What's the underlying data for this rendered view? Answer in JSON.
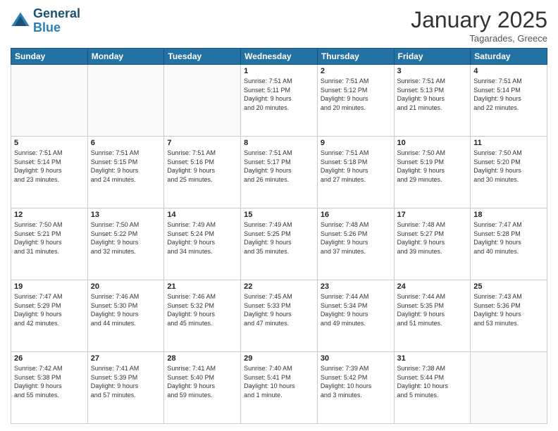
{
  "header": {
    "logo_line1": "General",
    "logo_line2": "Blue",
    "month": "January 2025",
    "location": "Tagarades, Greece"
  },
  "weekdays": [
    "Sunday",
    "Monday",
    "Tuesday",
    "Wednesday",
    "Thursday",
    "Friday",
    "Saturday"
  ],
  "weeks": [
    [
      {
        "day": "",
        "info": ""
      },
      {
        "day": "",
        "info": ""
      },
      {
        "day": "",
        "info": ""
      },
      {
        "day": "1",
        "info": "Sunrise: 7:51 AM\nSunset: 5:11 PM\nDaylight: 9 hours\nand 20 minutes."
      },
      {
        "day": "2",
        "info": "Sunrise: 7:51 AM\nSunset: 5:12 PM\nDaylight: 9 hours\nand 20 minutes."
      },
      {
        "day": "3",
        "info": "Sunrise: 7:51 AM\nSunset: 5:13 PM\nDaylight: 9 hours\nand 21 minutes."
      },
      {
        "day": "4",
        "info": "Sunrise: 7:51 AM\nSunset: 5:14 PM\nDaylight: 9 hours\nand 22 minutes."
      }
    ],
    [
      {
        "day": "5",
        "info": "Sunrise: 7:51 AM\nSunset: 5:14 PM\nDaylight: 9 hours\nand 23 minutes."
      },
      {
        "day": "6",
        "info": "Sunrise: 7:51 AM\nSunset: 5:15 PM\nDaylight: 9 hours\nand 24 minutes."
      },
      {
        "day": "7",
        "info": "Sunrise: 7:51 AM\nSunset: 5:16 PM\nDaylight: 9 hours\nand 25 minutes."
      },
      {
        "day": "8",
        "info": "Sunrise: 7:51 AM\nSunset: 5:17 PM\nDaylight: 9 hours\nand 26 minutes."
      },
      {
        "day": "9",
        "info": "Sunrise: 7:51 AM\nSunset: 5:18 PM\nDaylight: 9 hours\nand 27 minutes."
      },
      {
        "day": "10",
        "info": "Sunrise: 7:50 AM\nSunset: 5:19 PM\nDaylight: 9 hours\nand 29 minutes."
      },
      {
        "day": "11",
        "info": "Sunrise: 7:50 AM\nSunset: 5:20 PM\nDaylight: 9 hours\nand 30 minutes."
      }
    ],
    [
      {
        "day": "12",
        "info": "Sunrise: 7:50 AM\nSunset: 5:21 PM\nDaylight: 9 hours\nand 31 minutes."
      },
      {
        "day": "13",
        "info": "Sunrise: 7:50 AM\nSunset: 5:22 PM\nDaylight: 9 hours\nand 32 minutes."
      },
      {
        "day": "14",
        "info": "Sunrise: 7:49 AM\nSunset: 5:24 PM\nDaylight: 9 hours\nand 34 minutes."
      },
      {
        "day": "15",
        "info": "Sunrise: 7:49 AM\nSunset: 5:25 PM\nDaylight: 9 hours\nand 35 minutes."
      },
      {
        "day": "16",
        "info": "Sunrise: 7:48 AM\nSunset: 5:26 PM\nDaylight: 9 hours\nand 37 minutes."
      },
      {
        "day": "17",
        "info": "Sunrise: 7:48 AM\nSunset: 5:27 PM\nDaylight: 9 hours\nand 39 minutes."
      },
      {
        "day": "18",
        "info": "Sunrise: 7:47 AM\nSunset: 5:28 PM\nDaylight: 9 hours\nand 40 minutes."
      }
    ],
    [
      {
        "day": "19",
        "info": "Sunrise: 7:47 AM\nSunset: 5:29 PM\nDaylight: 9 hours\nand 42 minutes."
      },
      {
        "day": "20",
        "info": "Sunrise: 7:46 AM\nSunset: 5:30 PM\nDaylight: 9 hours\nand 44 minutes."
      },
      {
        "day": "21",
        "info": "Sunrise: 7:46 AM\nSunset: 5:32 PM\nDaylight: 9 hours\nand 45 minutes."
      },
      {
        "day": "22",
        "info": "Sunrise: 7:45 AM\nSunset: 5:33 PM\nDaylight: 9 hours\nand 47 minutes."
      },
      {
        "day": "23",
        "info": "Sunrise: 7:44 AM\nSunset: 5:34 PM\nDaylight: 9 hours\nand 49 minutes."
      },
      {
        "day": "24",
        "info": "Sunrise: 7:44 AM\nSunset: 5:35 PM\nDaylight: 9 hours\nand 51 minutes."
      },
      {
        "day": "25",
        "info": "Sunrise: 7:43 AM\nSunset: 5:36 PM\nDaylight: 9 hours\nand 53 minutes."
      }
    ],
    [
      {
        "day": "26",
        "info": "Sunrise: 7:42 AM\nSunset: 5:38 PM\nDaylight: 9 hours\nand 55 minutes."
      },
      {
        "day": "27",
        "info": "Sunrise: 7:41 AM\nSunset: 5:39 PM\nDaylight: 9 hours\nand 57 minutes."
      },
      {
        "day": "28",
        "info": "Sunrise: 7:41 AM\nSunset: 5:40 PM\nDaylight: 9 hours\nand 59 minutes."
      },
      {
        "day": "29",
        "info": "Sunrise: 7:40 AM\nSunset: 5:41 PM\nDaylight: 10 hours\nand 1 minute."
      },
      {
        "day": "30",
        "info": "Sunrise: 7:39 AM\nSunset: 5:42 PM\nDaylight: 10 hours\nand 3 minutes."
      },
      {
        "day": "31",
        "info": "Sunrise: 7:38 AM\nSunset: 5:44 PM\nDaylight: 10 hours\nand 5 minutes."
      },
      {
        "day": "",
        "info": ""
      }
    ]
  ]
}
